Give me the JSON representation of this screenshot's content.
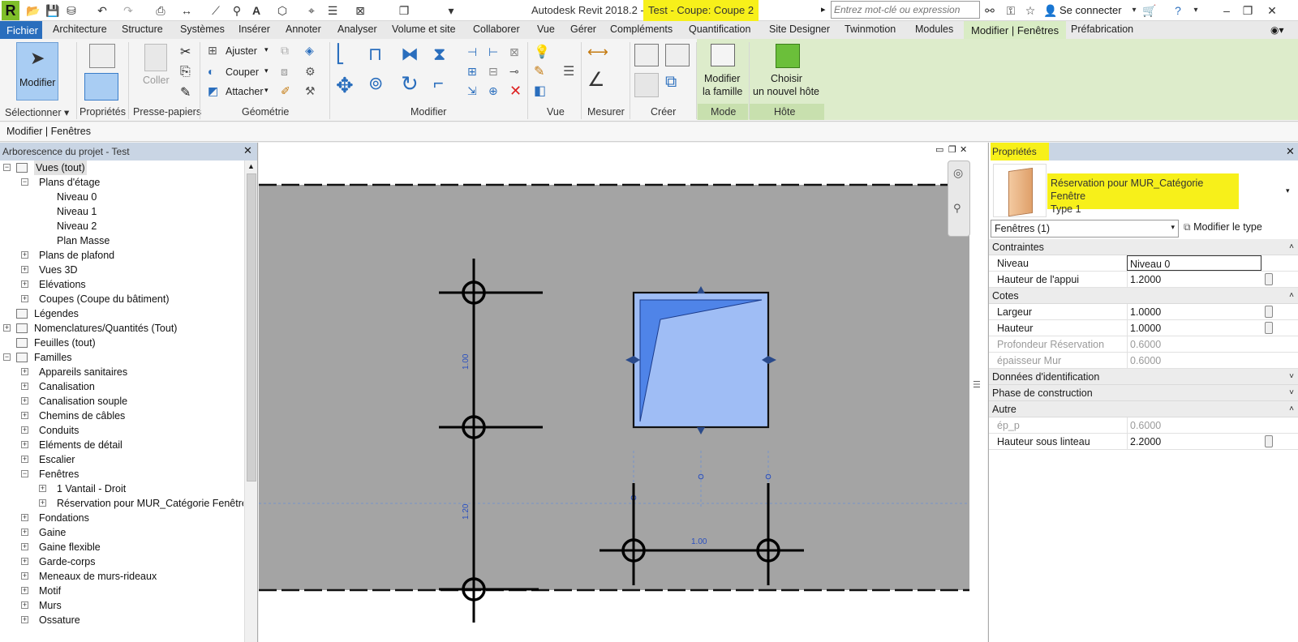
{
  "title_bar": {
    "app_title": "Autodesk Revit 2018.2 -",
    "doc_title": "Test - Coupe: Coupe 2",
    "search_placeholder": "Entrez mot-clé ou expression",
    "sign_in": "Se connecter"
  },
  "tabs": [
    "Fichier",
    "Architecture",
    "Structure",
    "Systèmes",
    "Insérer",
    "Annoter",
    "Analyser",
    "Volume et site",
    "Collaborer",
    "Vue",
    "Gérer",
    "Compléments",
    "Quantification",
    "Site Designer",
    "Twinmotion",
    "Modules",
    "Modifier | Fenêtres",
    "Préfabrication"
  ],
  "ribbon": {
    "modifier_label": "Modifier",
    "coller_label": "Coller",
    "ajuster": "Ajuster",
    "couper": "Couper",
    "attacher": "Attacher",
    "modifier_famille": [
      "Modifier",
      "la famille"
    ],
    "choisir_hote": [
      "Choisir",
      "un nouvel hôte"
    ],
    "panels": [
      "Sélectionner",
      "Propriétés",
      "Presse-papiers",
      "Géométrie",
      "Modifier",
      "Vue",
      "Mesurer",
      "Créer",
      "Mode",
      "Hôte"
    ]
  },
  "options_bar": {
    "context": "Modifier | Fenêtres"
  },
  "project_browser": {
    "header": "Arborescence du projet - Test",
    "items": [
      {
        "label": "Vues (tout)",
        "level": 0,
        "toggle": "-",
        "selected": true
      },
      {
        "label": "Plans d'étage",
        "level": 1,
        "toggle": "-"
      },
      {
        "label": "Niveau 0",
        "level": 2,
        "toggle": ""
      },
      {
        "label": "Niveau 1",
        "level": 2,
        "toggle": ""
      },
      {
        "label": "Niveau 2",
        "level": 2,
        "toggle": ""
      },
      {
        "label": "Plan Masse",
        "level": 2,
        "toggle": ""
      },
      {
        "label": "Plans de plafond",
        "level": 1,
        "toggle": "+"
      },
      {
        "label": "Vues 3D",
        "level": 1,
        "toggle": "+"
      },
      {
        "label": "Elévations",
        "level": 1,
        "toggle": "+"
      },
      {
        "label": "Coupes (Coupe du bâtiment)",
        "level": 1,
        "toggle": "+"
      },
      {
        "label": "Légendes",
        "level": 0,
        "toggle": ""
      },
      {
        "label": "Nomenclatures/Quantités (Tout)",
        "level": 0,
        "toggle": "+"
      },
      {
        "label": "Feuilles (tout)",
        "level": 0,
        "toggle": ""
      },
      {
        "label": "Familles",
        "level": 0,
        "toggle": "-"
      },
      {
        "label": "Appareils sanitaires",
        "level": 1,
        "toggle": "+"
      },
      {
        "label": "Canalisation",
        "level": 1,
        "toggle": "+"
      },
      {
        "label": "Canalisation souple",
        "level": 1,
        "toggle": "+"
      },
      {
        "label": "Chemins de câbles",
        "level": 1,
        "toggle": "+"
      },
      {
        "label": "Conduits",
        "level": 1,
        "toggle": "+"
      },
      {
        "label": "Eléments de détail",
        "level": 1,
        "toggle": "+"
      },
      {
        "label": "Escalier",
        "level": 1,
        "toggle": "+"
      },
      {
        "label": "Fenêtres",
        "level": 1,
        "toggle": "-"
      },
      {
        "label": "1 Vantail - Droit",
        "level": 2,
        "toggle": "+"
      },
      {
        "label": "Réservation pour MUR_Catégorie Fenêtre",
        "level": 2,
        "toggle": "+"
      },
      {
        "label": "Fondations",
        "level": 1,
        "toggle": "+"
      },
      {
        "label": "Gaine",
        "level": 1,
        "toggle": "+"
      },
      {
        "label": "Gaine flexible",
        "level": 1,
        "toggle": "+"
      },
      {
        "label": "Garde-corps",
        "level": 1,
        "toggle": "+"
      },
      {
        "label": "Meneaux de murs-rideaux",
        "level": 1,
        "toggle": "+"
      },
      {
        "label": "Motif",
        "level": 1,
        "toggle": "+"
      },
      {
        "label": "Murs",
        "level": 1,
        "toggle": "+"
      },
      {
        "label": "Ossature",
        "level": 1,
        "toggle": "+"
      }
    ]
  },
  "canvas": {
    "dim_vertical_top": "1.00",
    "dim_vertical_bottom": "1.20",
    "dim_horizontal": "1.00"
  },
  "properties": {
    "header": "Propriétés",
    "type_name_line1": "Réservation pour MUR_Catégorie Fenêtre",
    "type_name_line2": "Type 1",
    "instance_filter": "Fenêtres (1)",
    "edit_type": "Modifier le type",
    "groups": [
      {
        "label": "Contraintes",
        "rows": [
          {
            "label": "Niveau",
            "value": "Niveau 0",
            "editable": true
          },
          {
            "label": "Hauteur de l'appui",
            "value": "1.2000",
            "editable": true
          }
        ]
      },
      {
        "label": "Cotes",
        "rows": [
          {
            "label": "Largeur",
            "value": "1.0000",
            "editable": true
          },
          {
            "label": "Hauteur",
            "value": "1.0000",
            "editable": true
          },
          {
            "label": "Profondeur Réservation",
            "value": "0.6000",
            "editable": false
          },
          {
            "label": "épaisseur Mur",
            "value": "0.6000",
            "editable": false
          }
        ]
      },
      {
        "label": "Données d'identification",
        "rows": []
      },
      {
        "label": "Phase de construction",
        "rows": []
      },
      {
        "label": "Autre",
        "rows": [
          {
            "label": "ép_p",
            "value": "0.6000",
            "editable": false
          },
          {
            "label": "Hauteur sous linteau",
            "value": "2.2000",
            "editable": true
          }
        ]
      }
    ]
  },
  "colors": {
    "accent": "#2a6ebd",
    "selection_fill": "#9fbdf5",
    "highlight": "#f7f01a",
    "context_tab": "#d9ecc5"
  }
}
